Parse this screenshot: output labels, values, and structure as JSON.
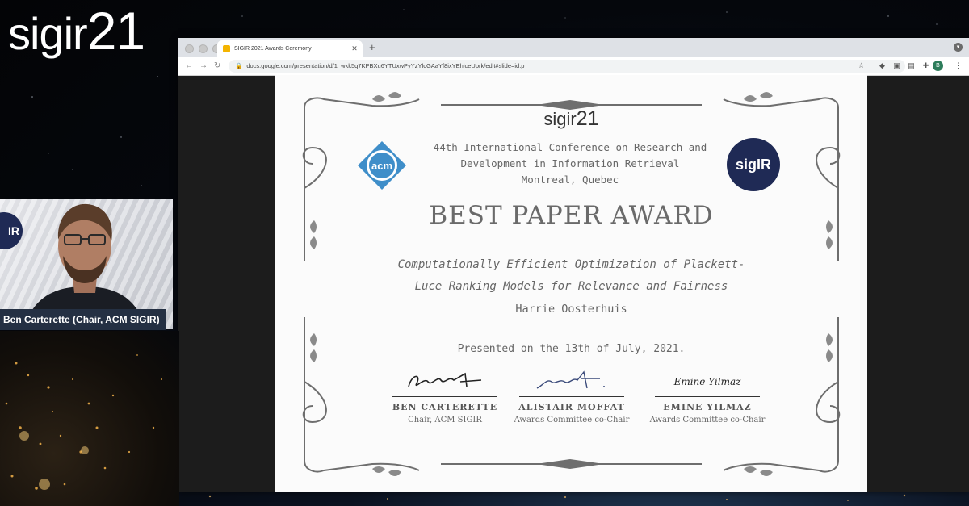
{
  "brand": {
    "text": "sigir",
    "num": "21"
  },
  "browser": {
    "tab_title": "SIGIR 2021 Awards Ceremony",
    "tab_close": "✕",
    "new_tab": "+",
    "url": "docs.google.com/presentation/d/1_wkk5q7KPBXu6YTUxwPyYzYlcGAaYf8ixYEhlceUprk/edit#slide=id.p",
    "profile_initial": "B"
  },
  "slide": {
    "logo_text": "sigir",
    "logo_num": "21",
    "acm_label": "acm",
    "sigir_badge": "sigIR",
    "conference_lines": [
      "44th International Conference on Research and",
      "Development in Information Retrieval",
      "Montreal, Quebec"
    ],
    "award": "BEST PAPER AWARD",
    "paper_title_lines": [
      "Computationally Efficient Optimization of Plackett-",
      "Luce Ranking Models for Relevance and Fairness"
    ],
    "author": "Harrie Oosterhuis",
    "presented": "Presented on the 13th of July, 2021.",
    "signatories": [
      {
        "name": "BEN CARTERETTE",
        "role": "Chair, ACM SIGIR",
        "sign_text": ""
      },
      {
        "name": "ALISTAIR MOFFAT",
        "role": "Awards Committee co-Chair",
        "sign_text": ""
      },
      {
        "name": "EMINE YILMAZ",
        "role": "Awards Committee co-Chair",
        "sign_text": "Emine Yilmaz"
      }
    ]
  },
  "webcam": {
    "badge": "IR",
    "caption": "Ben Carterette (Chair, ACM SIGIR)"
  },
  "colors": {
    "sigir_navy": "#1f2a55",
    "acm_blue": "#3f8ec9",
    "caption_bg": "#243043"
  }
}
